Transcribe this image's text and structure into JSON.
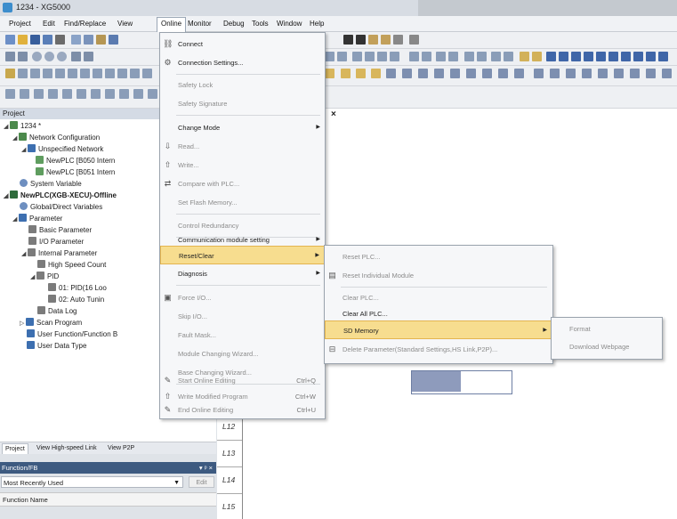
{
  "window": {
    "title": "1234 - XG5000"
  },
  "menubar": [
    "Project",
    "Edit",
    "Find/Replace",
    "View",
    "Online",
    "Monitor",
    "Debug",
    "Tools",
    "Window",
    "Help"
  ],
  "project_panel": {
    "header": "Project",
    "tree": [
      "1234 *",
      "Network Configuration",
      "Unspecified Network",
      "NewPLC [B050 Intern",
      "NewPLC [B051 Intern",
      "System Variable",
      "NewPLC(XGB-XECU)-Offline",
      "Global/Direct Variables",
      "Parameter",
      "Basic Parameter",
      "I/O Parameter",
      "Internal Parameter",
      "High Speed Count",
      "PID",
      "01: PID(16 Loo",
      "02: Auto Tunin",
      "Data Log",
      "Scan Program",
      "User Function/Function B",
      "User Data Type"
    ],
    "tabs": [
      "Project",
      "View High-speed Link",
      "View P2P"
    ]
  },
  "function_fb": {
    "header": "Function/FB",
    "header_controls": "▾ ᵖ ×",
    "selected": "Most Recently Used",
    "edit_label": "Edit",
    "column": "Function Name"
  },
  "ladder": {
    "rungs": [
      "L12",
      "L13",
      "L14",
      "L15"
    ],
    "tab_close": "×"
  },
  "online_menu": {
    "items": [
      {
        "label": "Connect",
        "shortcut": "",
        "disabled": false
      },
      {
        "label": "Connection Settings...",
        "shortcut": "",
        "disabled": false
      },
      {
        "label": "Safety Lock",
        "shortcut": "",
        "disabled": true
      },
      {
        "label": "Safety Signature",
        "shortcut": "",
        "disabled": true
      },
      {
        "label": "Change Mode",
        "shortcut": "",
        "disabled": false
      },
      {
        "label": "Read...",
        "shortcut": "",
        "disabled": true
      },
      {
        "label": "Write...",
        "shortcut": "",
        "disabled": true
      },
      {
        "label": "Compare with PLC...",
        "shortcut": "",
        "disabled": true
      },
      {
        "label": "Set Flash Memory...",
        "shortcut": "",
        "disabled": true
      },
      {
        "label": "Control Redundancy",
        "shortcut": "",
        "disabled": true
      },
      {
        "label": "Communication module setting",
        "shortcut": "",
        "disabled": false
      },
      {
        "label": "Reset/Clear",
        "shortcut": "",
        "disabled": false
      },
      {
        "label": "Diagnosis",
        "shortcut": "",
        "disabled": false
      },
      {
        "label": "Force I/O...",
        "shortcut": "",
        "disabled": true
      },
      {
        "label": "Skip I/O...",
        "shortcut": "",
        "disabled": true
      },
      {
        "label": "Fault Mask...",
        "shortcut": "",
        "disabled": true
      },
      {
        "label": "Module Changing Wizard...",
        "shortcut": "",
        "disabled": true
      },
      {
        "label": "Base Changing Wizard...",
        "shortcut": "",
        "disabled": true
      },
      {
        "label": "Start Online Editing",
        "shortcut": "Ctrl+Q",
        "disabled": true
      },
      {
        "label": "Write Modified Program",
        "shortcut": "Ctrl+W",
        "disabled": true
      },
      {
        "label": "End Online Editing",
        "shortcut": "Ctrl+U",
        "disabled": true
      }
    ]
  },
  "reset_menu": {
    "items": [
      {
        "label": "Reset PLC...",
        "disabled": true
      },
      {
        "label": "Reset Individual Module",
        "disabled": true
      },
      {
        "label": "Clear PLC...",
        "disabled": true
      },
      {
        "label": "Clear All PLC...",
        "disabled": false
      },
      {
        "label": "SD Memory",
        "disabled": false
      },
      {
        "label": "Delete Parameter(Standard Settings,HS Link,P2P)...",
        "disabled": true
      }
    ]
  },
  "sd_menu": {
    "items": [
      {
        "label": "Format",
        "disabled": true
      },
      {
        "label": "Download Webpage",
        "disabled": true
      }
    ]
  },
  "colors": {
    "accent": "#3d5a80",
    "highlight": "#f7dd8f",
    "highlight_border": "#e4b44f",
    "rung_fill": "#8e9bbc"
  }
}
